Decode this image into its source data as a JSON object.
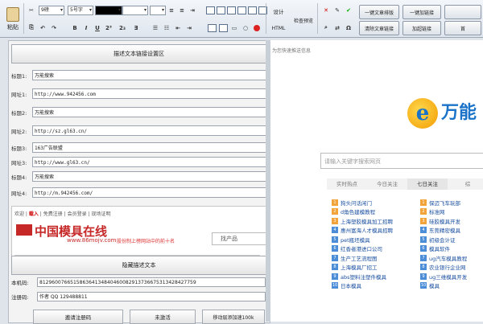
{
  "toolbar": {
    "paste": "粘贴",
    "font_size": "9磅",
    "font_name": "5号字",
    "design": "设计",
    "html": "HTML",
    "preview": "检查预览",
    "buttons": [
      "一键文章排版",
      "一键加链接",
      "清除文章链接",
      "加超链接",
      "首"
    ],
    "format_icons": [
      "B",
      "I",
      "U",
      "2³",
      "2₃",
      "∃"
    ],
    "colors": [
      "#000000",
      "#ffffff",
      "#ff0000"
    ]
  },
  "left": {
    "set_button": "描述文本链接设置区",
    "rows": [
      {
        "label": "标题1:",
        "value": "万能搜索"
      },
      {
        "label": "网址1:",
        "value": "http://www.942456.com"
      },
      {
        "label": "标题2:",
        "value": "万能搜索"
      },
      {
        "label": "网址2:",
        "value": "http://sz.gl63.cn/"
      },
      {
        "label": "标题3:",
        "value": "163广告联盟"
      },
      {
        "label": "网址3:",
        "value": "http://www.gl63.cn/"
      },
      {
        "label": "标题4:",
        "value": "万能搜索"
      },
      {
        "label": "网址4:",
        "value": "http://m.942456.com/"
      }
    ],
    "ad": {
      "links": [
        "欢迎",
        "载入",
        "免费注册",
        "会员登录",
        "现场证明"
      ],
      "title": "中国模具在线",
      "domain": "www.86mojv.com",
      "slogan": "股份制上榜网站中的前十名",
      "search": "找产品"
    },
    "hide_button": "隐藏描述文本",
    "machine_label": "本机码:",
    "machine_value": "812960076651586364134840460082913736675313428427759",
    "reg_label": "注册码:",
    "reg_value": "作者 QQ 129488811",
    "bottom_buttons": [
      "邀请注册码",
      "未激活",
      "移动层添加速100k"
    ]
  },
  "browser": {
    "address": "为您快速推送信息",
    "brand": "万能",
    "search_placeholder": "请输入关键字搜索网页",
    "tabs": [
      "实时热点",
      "今日关注",
      "七日关注",
      "综"
    ],
    "news_left": [
      "狗头问话闲门",
      "d角色建模教程",
      "上海塑胶模具加工招聘",
      "惠州富海人才模具招聘",
      "pet瓶坯模具",
      "红香者港进口公司",
      "生产工艺流程图",
      "上海模具厂招工",
      "abs塑料注塑件模具",
      "日本模具"
    ],
    "news_right": [
      "保迈飞车玩部",
      "标准网",
      "硅胶模具开发",
      "东莞精密模具",
      "初级会计证",
      "模具软件",
      "ug汽车模具教程",
      "农业银行企业网",
      "ug三维模具开发",
      "模具"
    ]
  }
}
